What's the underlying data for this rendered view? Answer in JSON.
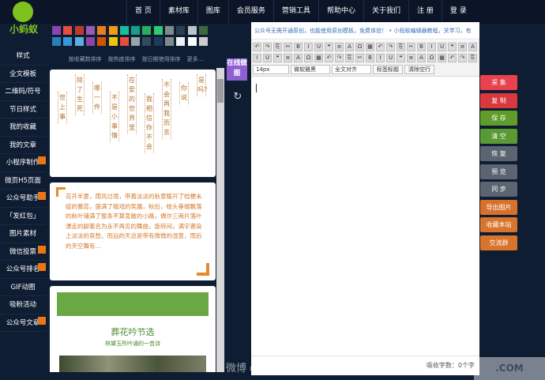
{
  "brand": {
    "name": "小蚂蚁",
    "color": "#7dc21e"
  },
  "topnav": [
    "首 页",
    "素材库",
    "图库",
    "会员服务",
    "营销工具",
    "帮助中心",
    "关于我们",
    "注 册",
    "登 录"
  ],
  "sidebar": [
    {
      "label": "样式",
      "badge": false
    },
    {
      "label": "全文模板",
      "badge": false
    },
    {
      "label": "二维码/符号",
      "badge": false
    },
    {
      "label": "节日样式",
      "badge": false
    },
    {
      "label": "我的收藏",
      "badge": false
    },
    {
      "label": "我的文章",
      "badge": false
    },
    {
      "label": "小程序制作",
      "badge": true
    },
    {
      "label": "微页H5页面",
      "badge": false
    },
    {
      "label": "公众号助手",
      "badge": true
    },
    {
      "label": "「发红包」",
      "badge": false
    },
    {
      "label": "图片素材",
      "badge": false
    },
    {
      "label": "微信投票",
      "badge": true
    },
    {
      "label": "公众号排名",
      "badge": true
    },
    {
      "label": "GIF动图",
      "badge": false
    },
    {
      "label": "吸粉活动",
      "badge": false
    },
    {
      "label": "公众号文章",
      "badge": true
    }
  ],
  "palette": {
    "row1": [
      "#8e44ad",
      "#e74c3c",
      "#c0392b",
      "#9b59b6",
      "#e67e22",
      "#f39c12",
      "#1abc9c",
      "#16a085",
      "#27ae60",
      "#2ecc71",
      "#7f8c8d",
      "#2c3e50",
      "#bdc3c7",
      "#3d6a3a"
    ],
    "row2": [
      "#2980b9",
      "#3498db",
      "#5dade2",
      "#8e44ad",
      "#d35400",
      "#f1c40f",
      "#e74c3c",
      "#95a5a6",
      "#34495e",
      "#1f3a5f",
      "#7f8c8d",
      "#ecf0f1",
      "#ffffff",
      "#cccccc"
    ]
  },
  "filters": [
    "按收藏数排序",
    "按热度排序",
    "按日期使用排序",
    "更多..."
  ],
  "card1": {
    "columns": [
      "世上事",
      "除了生死",
      "哪一件",
      "不是小事情",
      "在爱的世界里",
      "我相信你不会",
      "不会再我而去",
      "你说",
      "是吗?"
    ]
  },
  "card2": {
    "text": "花开半夏，雨风过境，带着淡淡的秋意暖开了桔梗未绽的蕾蕊，盛满了嬉戏的笑靥，秋后，枝头垂缀飘落的秋叶铺满了整条不算宽敞的小路，偶尔三两片落叶漂走的脚着名为永不再见的舞曲，旋转间，满宇袭染上淡淡的哀愁。而远的天总是带有微微的湿意，雨后的天空舞有..."
  },
  "card3": {
    "title": "葬花吟节选",
    "subtitle": "林黛玉所吟诵的一首诗"
  },
  "online_button": "在线做图",
  "editor": {
    "notice": "公众号无需开通原创，也能使用原创模板，免费体验！ • 小蚂蚁编辑器教程，关学习，有",
    "font_size": "14px",
    "font_family": "微软雅黑",
    "align": "全文对齐",
    "title_btn": "标签标题",
    "clear_btn": "清除空行",
    "status": "吸收字数：0个字",
    "toolbar_icons": [
      "↶",
      "↷",
      "⎘",
      "✂",
      "B",
      "I",
      "U",
      "❝",
      "≡",
      "A",
      "Ω",
      "▦"
    ]
  },
  "actions": [
    {
      "label": "采 集",
      "color": "#e8424f"
    },
    {
      "label": "复 制",
      "color": "#d9383f"
    },
    {
      "label": "保 存",
      "color": "#5f9c2a"
    },
    {
      "label": "清 空",
      "color": "#5a9a33"
    },
    {
      "label": "恢 复",
      "color": "#5b6470"
    },
    {
      "label": "预 览",
      "color": "#5b6470"
    },
    {
      "label": "同 步",
      "color": "#5b6470"
    },
    {
      "label": "导出图片",
      "color": "#d5712b"
    },
    {
      "label": "收藏本站",
      "color": "#d8742b"
    },
    {
      "label": "交流群",
      "color": "#d8742b"
    }
  ],
  "watermark": "微博 @瑞言德信"
}
